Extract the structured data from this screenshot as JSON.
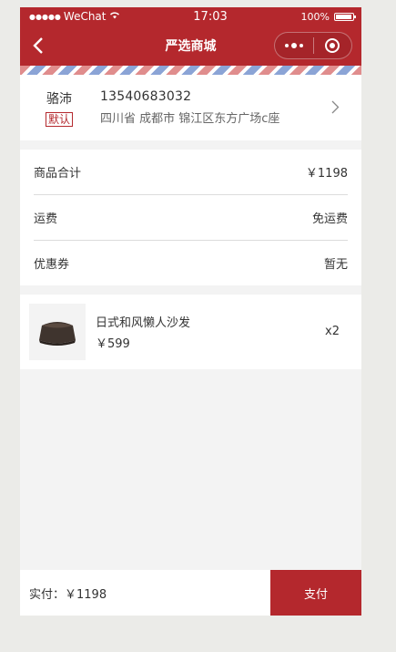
{
  "status_bar": {
    "signal": "●●●●●",
    "carrier": "WeChat",
    "time": "17:03",
    "battery": "100%"
  },
  "nav": {
    "title": "严选商城"
  },
  "address": {
    "name": "骆沛",
    "default_tag": "默认",
    "phone": "13540683032",
    "detail": "四川省 成都市 锦江区东方广场c座"
  },
  "summary": {
    "rows": [
      {
        "label": "商品合计",
        "value": "￥1198"
      },
      {
        "label": "运费",
        "value": "免运费"
      },
      {
        "label": "优惠券",
        "value": "暂无"
      }
    ]
  },
  "goods": {
    "name": "日式和风懒人沙发",
    "price": "￥599",
    "quantity": "x2"
  },
  "footer": {
    "total": "实付：￥1198",
    "pay_label": "支付"
  },
  "colors": {
    "brand": "#b4282d",
    "background": "#f3f3f3"
  }
}
